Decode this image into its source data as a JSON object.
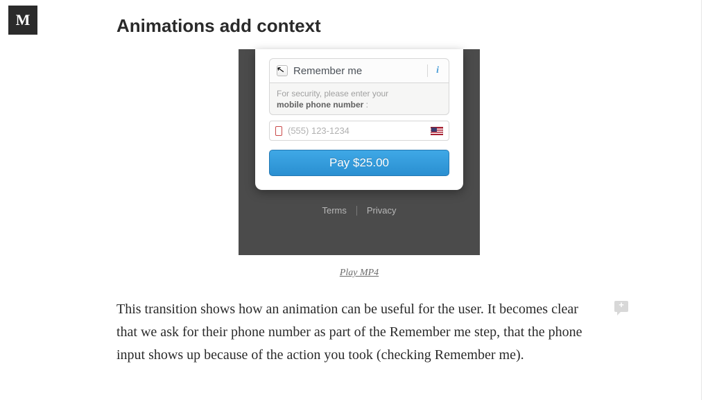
{
  "logo_letter": "M",
  "heading": "Animations add context",
  "figure": {
    "remember_label": "Remember me",
    "security_prefix": "For security, please enter your",
    "security_bold": "mobile phone number",
    "security_suffix": " :",
    "phone_placeholder": "(555) 123-1234",
    "pay_button": "Pay $25.00",
    "terms": "Terms",
    "privacy": "Privacy"
  },
  "caption_link": "Play MP4",
  "paragraph": "This transition shows how an animation can be useful for the user. It becomes clear that we ask for their phone number as part of the Remember me step, that the phone input shows up because of the action you took (checking Remember me)."
}
